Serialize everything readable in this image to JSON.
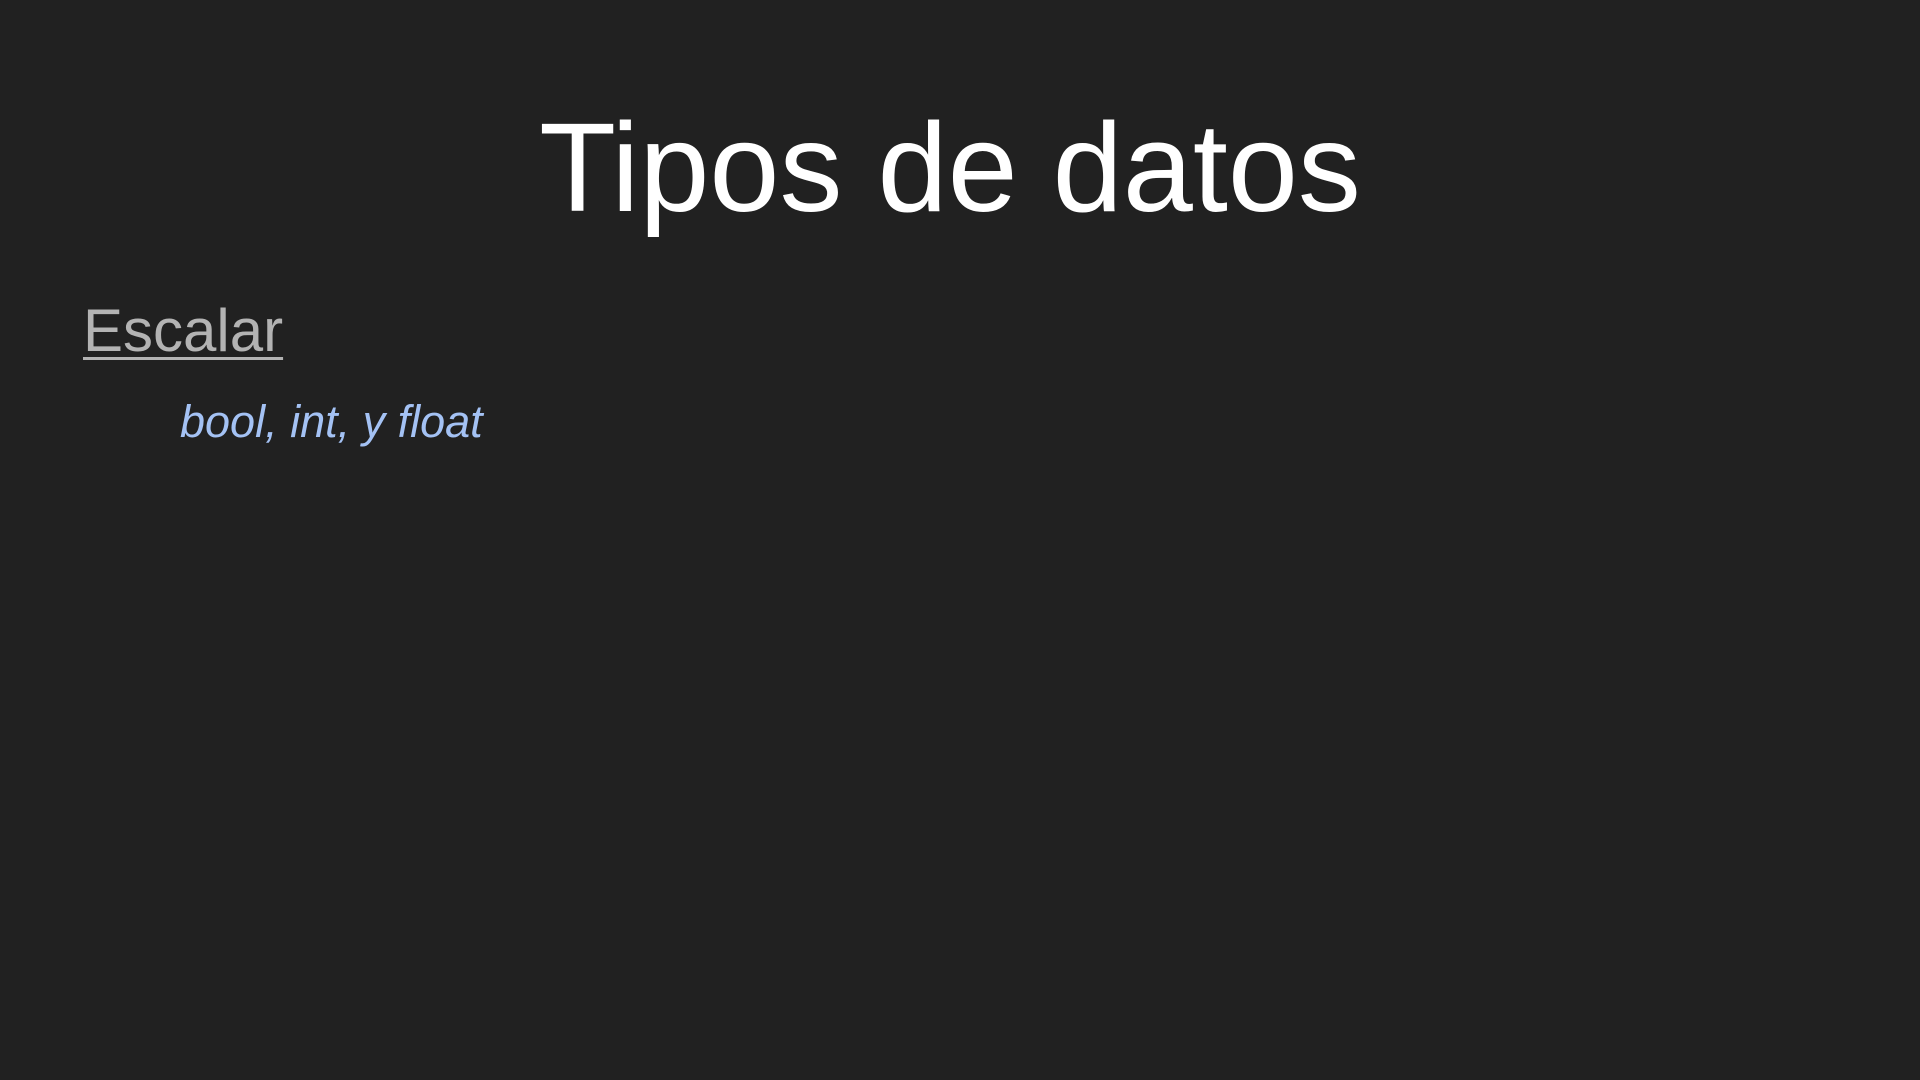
{
  "slide": {
    "title": "Tipos de datos",
    "section": {
      "heading": "Escalar",
      "items": "bool, int, y float"
    }
  },
  "colors": {
    "background": "#212121",
    "title": "#ffffff",
    "heading": "#b3b3b3",
    "items": "#a4c2f4"
  }
}
